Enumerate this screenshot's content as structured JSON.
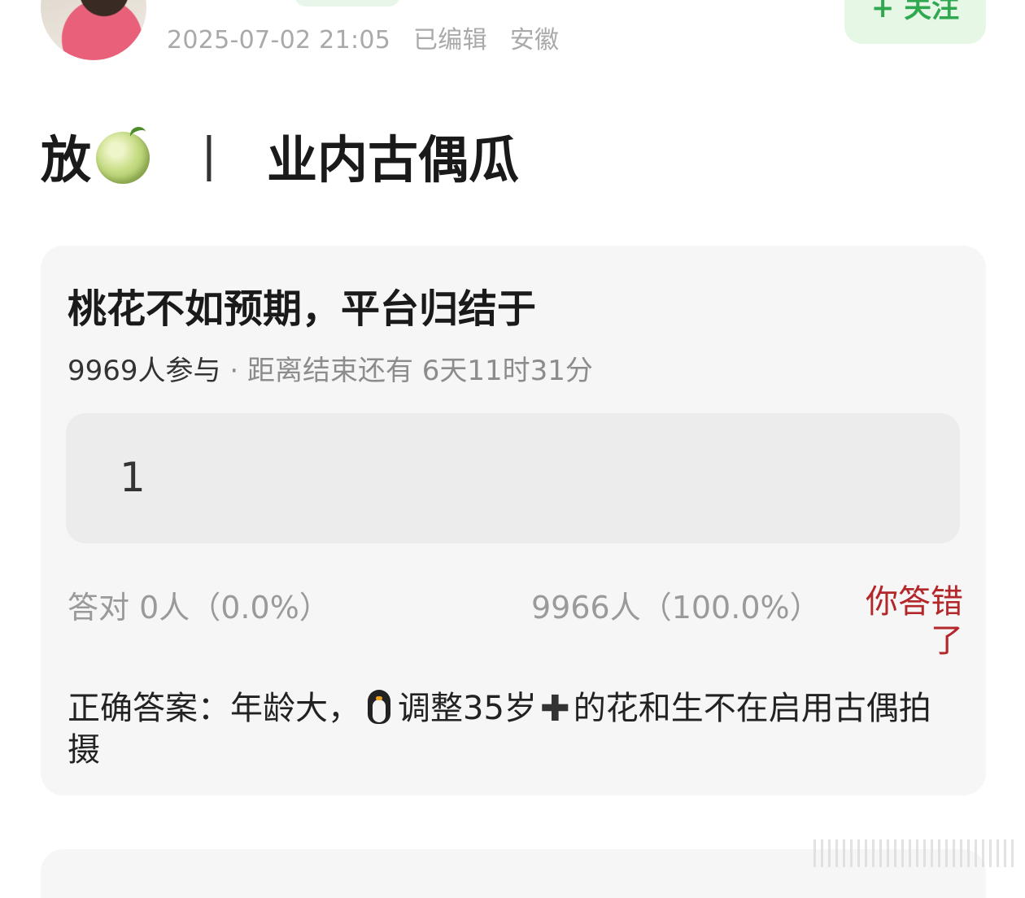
{
  "post": {
    "meta_time": "2025-07-02 21:05",
    "meta_edited": "已编辑",
    "meta_location": "安徽",
    "follow_label": "+ 关注",
    "title_prefix": "放",
    "title_divider": "丨",
    "title_suffix": "业内古偶瓜"
  },
  "quiz": {
    "question": "桃花不如预期，平台归结于",
    "participants": "9969人参与",
    "separator": " · ",
    "time_left": "距离结束还有 6天11时31分",
    "option_value": "1",
    "correct_stat": "答对  0人（0.0%）",
    "wrong_stat": "9966人（100.0%）",
    "wrong_label": "你答错了",
    "answer_part1": "正确答案：年龄大，",
    "answer_part2": "调整35岁",
    "answer_part3": "的花和生不在启用古偶拍摄"
  },
  "icons": {
    "title_emoji": "melon-icon",
    "answer_emoji_1": "penguin-icon",
    "answer_emoji_2": "plus-icon"
  },
  "colors": {
    "follow_green": "#2fa84f",
    "wrong_red": "#b3262a",
    "card_bg": "#f6f6f6"
  }
}
